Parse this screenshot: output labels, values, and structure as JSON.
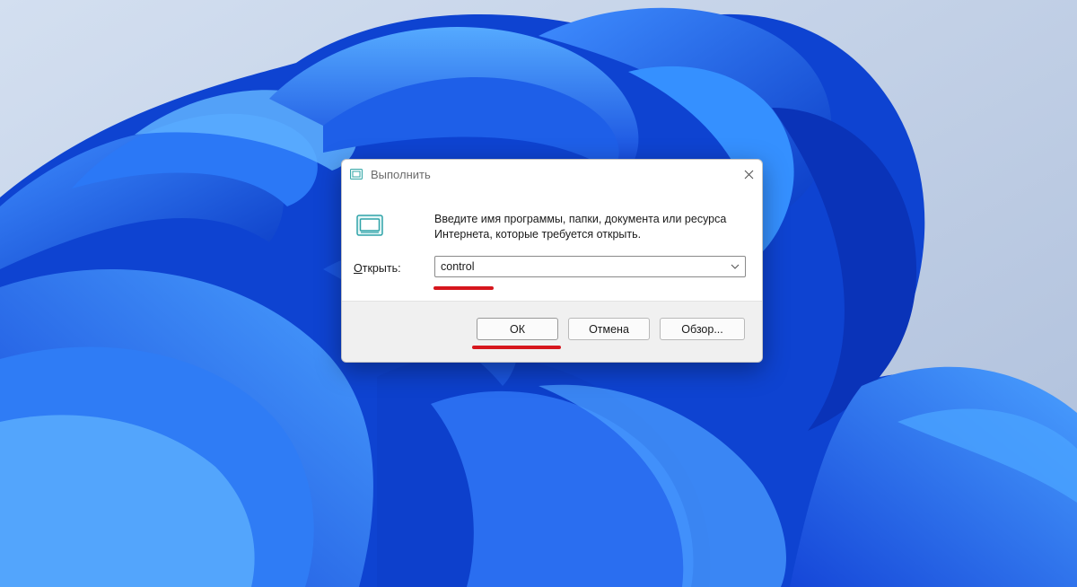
{
  "window": {
    "title": "Выполнить",
    "close_icon": "close-icon",
    "title_icon": "run-icon"
  },
  "description": {
    "line1": "Введите имя программы, папки, документа или ресурса",
    "line2": "Интернета, которые требуется открыть."
  },
  "open_field": {
    "label_accel": "О",
    "label_rest": "ткрыть:",
    "value": "control",
    "dropdown_icon": "chevron-down-icon"
  },
  "buttons": {
    "ok": "ОК",
    "cancel": "Отмена",
    "browse": "Обзор..."
  },
  "colors": {
    "highlight_underline": "#d6161d",
    "wallpaper_blue": "#1c52e8"
  }
}
